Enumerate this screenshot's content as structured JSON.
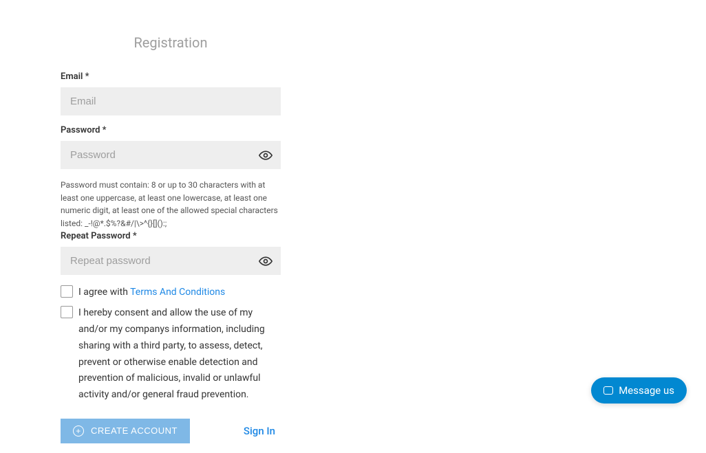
{
  "title": "Registration",
  "fields": {
    "email": {
      "label": "Email *",
      "placeholder": "Email"
    },
    "password": {
      "label": "Password *",
      "placeholder": "Password",
      "hint": "Password must contain: 8 or up to 30 characters with at least one uppercase, at least one lowercase, at least one numeric digit, at least one of the allowed special characters listed: _-!@*.$%?&#/|\\>^{}[]():;"
    },
    "repeat": {
      "label": "Repeat Password *",
      "placeholder": "Repeat password"
    }
  },
  "checkboxes": {
    "terms_prefix": "I agree with ",
    "terms_link": "Terms And Conditions",
    "consent": "I hereby consent and allow the use of my and/or my companys information, including sharing with a third party, to assess, detect, prevent or otherwise enable detection and prevention of malicious, invalid or unlawful activity and/or general fraud prevention."
  },
  "buttons": {
    "create": "CREATE ACCOUNT",
    "signin": "Sign In"
  },
  "widget": {
    "label": "Message us"
  }
}
